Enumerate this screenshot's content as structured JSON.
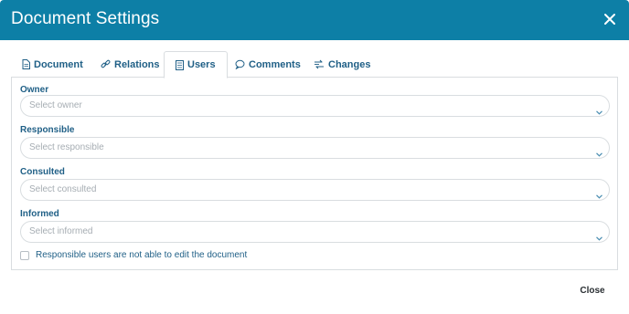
{
  "dialog": {
    "title": "Document Settings",
    "close_label": "Close"
  },
  "tabs": [
    {
      "label": "Document",
      "icon": "document-icon",
      "active": false
    },
    {
      "label": "Relations",
      "icon": "link-icon",
      "active": false
    },
    {
      "label": "Users",
      "icon": "users-list-icon",
      "active": true
    },
    {
      "label": "Comments",
      "icon": "comment-icon",
      "active": false
    },
    {
      "label": "Changes",
      "icon": "changes-icon",
      "active": false
    }
  ],
  "fields": {
    "owner": {
      "label": "Owner",
      "placeholder": "Select owner"
    },
    "responsible": {
      "label": "Responsible",
      "placeholder": "Select responsible"
    },
    "consulted": {
      "label": "Consulted",
      "placeholder": "Select consulted"
    },
    "informed": {
      "label": "Informed",
      "placeholder": "Select informed"
    }
  },
  "checkbox": {
    "label": "Responsible users are not able to edit the document",
    "checked": false
  },
  "colors": {
    "header": "#0d7fa6",
    "accent_text": "#1f5f86",
    "border": "#d9dde0",
    "placeholder": "#a6adb3"
  }
}
